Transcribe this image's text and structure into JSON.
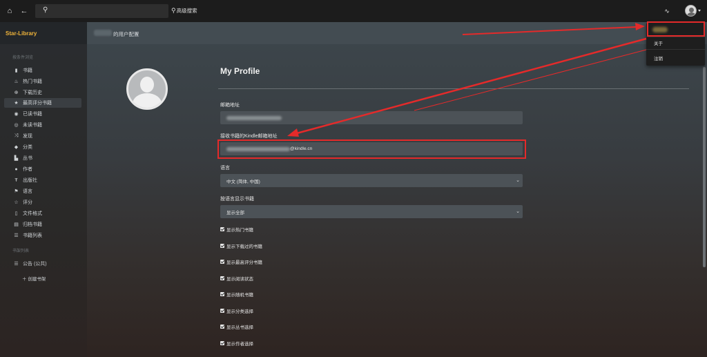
{
  "topbar": {
    "home_icon": "home-icon",
    "back_icon": "back-arrow-icon",
    "search_placeholder": "",
    "advanced_search": "高级搜索",
    "activity_icon": "activity-icon"
  },
  "sidebar": {
    "brand": "Star-Library",
    "browse_section": "按条件浏览",
    "items": [
      {
        "label": "书籍",
        "icon": "book-icon"
      },
      {
        "label": "热门书籍",
        "icon": "fire-icon"
      },
      {
        "label": "下载历史",
        "icon": "download-icon"
      },
      {
        "label": "最高评分书籍",
        "icon": "star-icon"
      },
      {
        "label": "已读书籍",
        "icon": "eye-icon"
      },
      {
        "label": "未读书籍",
        "icon": "eye-slash-icon"
      },
      {
        "label": "发现",
        "icon": "shuffle-icon"
      },
      {
        "label": "分类",
        "icon": "tags-icon"
      },
      {
        "label": "丛书",
        "icon": "bookmark-icon"
      },
      {
        "label": "作者",
        "icon": "user-icon"
      },
      {
        "label": "出版社",
        "icon": "publisher-icon"
      },
      {
        "label": "语言",
        "icon": "flag-icon"
      },
      {
        "label": "评分",
        "icon": "star-outline-icon"
      },
      {
        "label": "文件格式",
        "icon": "file-icon"
      },
      {
        "label": "归档书籍",
        "icon": "archive-icon"
      },
      {
        "label": "书籍列表",
        "icon": "list-icon"
      }
    ],
    "shelf_section": "书架列表",
    "shelves": [
      {
        "label": "公告 (公共)",
        "icon": "list-icon"
      }
    ],
    "create_shelf": "创建书架"
  },
  "main": {
    "breadcrumb_suffix": "的用户配置",
    "title": "My Profile",
    "email_label": "邮箱地址",
    "kindle_label": "接收书籍的Kindle邮箱地址",
    "kindle_value_suffix": "@kindle.cn",
    "language_label": "语言",
    "language_value": "中文 (简体, 中国)",
    "book_lang_label": "按语言显示书籍",
    "book_lang_value": "显示全部",
    "checkboxes": [
      "显示热门书籍",
      "显示下载过的书籍",
      "显示最高评分书籍",
      "显示阅读状态",
      "显示随机书籍",
      "显示分类选择",
      "显示丛书选择",
      "显示作者选择"
    ]
  },
  "dropdown": {
    "about": "关于",
    "logout": "注销"
  },
  "colors": {
    "brand": "#f0b43a",
    "highlight": "#e52a2a"
  }
}
